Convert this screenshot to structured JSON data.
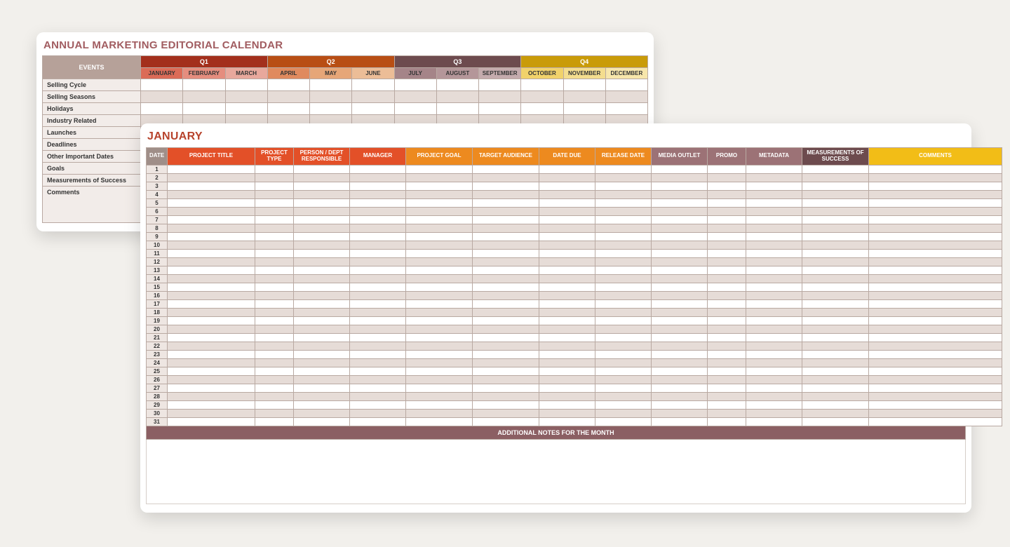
{
  "annual": {
    "title": "ANNUAL MARKETING EDITORIAL CALENDAR",
    "events_header": "EVENTS",
    "quarters": [
      "Q1",
      "Q2",
      "Q3",
      "Q4"
    ],
    "months": [
      "JANUARY",
      "FEBRUARY",
      "MARCH",
      "APRIL",
      "MAY",
      "JUNE",
      "JULY",
      "AUGUST",
      "SEPTEMBER",
      "OCTOBER",
      "NOVEMBER",
      "DECEMBER"
    ],
    "rows": [
      "Selling Cycle",
      "Selling Seasons",
      "Holidays",
      "Industry Related",
      "Launches",
      "Deadlines",
      "Other Important Dates",
      "Goals",
      "Measurements of Success",
      "Comments"
    ]
  },
  "detail": {
    "month_title": "JANUARY",
    "headers": [
      "DATE",
      "PROJECT TITLE",
      "PROJECT TYPE",
      "PERSON / DEPT RESPONSIBLE",
      "MANAGER",
      "PROJECT GOAL",
      "TARGET AUDIENCE",
      "DATE DUE",
      "RELEASE DATE",
      "MEDIA OUTLET",
      "PROMO",
      "METADATA",
      "MEASUREMENTS OF SUCCESS",
      "COMMENTS"
    ],
    "days": 31,
    "notes_label": "ADDITIONAL NOTES FOR THE MONTH"
  }
}
